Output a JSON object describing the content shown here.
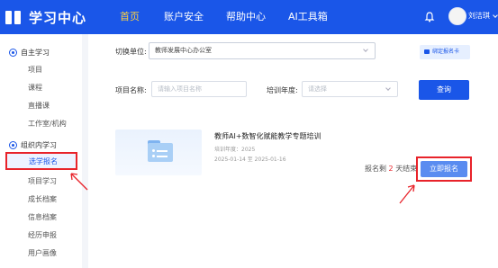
{
  "header": {
    "app_title": "学习中心",
    "nav": [
      {
        "label": "首页",
        "active": true
      },
      {
        "label": "账户安全",
        "active": false
      },
      {
        "label": "帮助中心",
        "active": false
      },
      {
        "label": "AI工具箱",
        "active": false
      }
    ],
    "username": "刘洁琪",
    "bar_color": "#1a56e8",
    "active_color": "#ffd23f"
  },
  "sidebar": {
    "groups": [
      {
        "label": "自主学习",
        "icon": "target-icon",
        "items": [
          "项目",
          "课程",
          "直播课",
          "工作室/机构"
        ]
      },
      {
        "label": "组织内学习",
        "icon": "target-icon",
        "items": [
          "选学报名",
          "项目学习",
          "成长档案",
          "信息档案",
          "经历申报",
          "用户画像"
        ]
      }
    ],
    "selected": "选学报名"
  },
  "filters": {
    "unit_label": "切换单位:",
    "unit_value": "教师发展中心办公室",
    "bind_button": "绑定报名卡",
    "project_name_label": "项目名称:",
    "project_name_placeholder": "请输入项目名称",
    "year_label": "培训年度:",
    "year_placeholder": "请选择",
    "query_button": "查询"
  },
  "course": {
    "title": "教师AI+数智化赋能教学专题培训",
    "year_line": "培训年度：2025",
    "date_line": "2025-01-14 至 2025-01-16",
    "remaining_prefix": "报名剩",
    "remaining_count": "2",
    "remaining_suffix": "天结束",
    "signup_button": "立即报名"
  },
  "annotation_color": "#e8232a"
}
